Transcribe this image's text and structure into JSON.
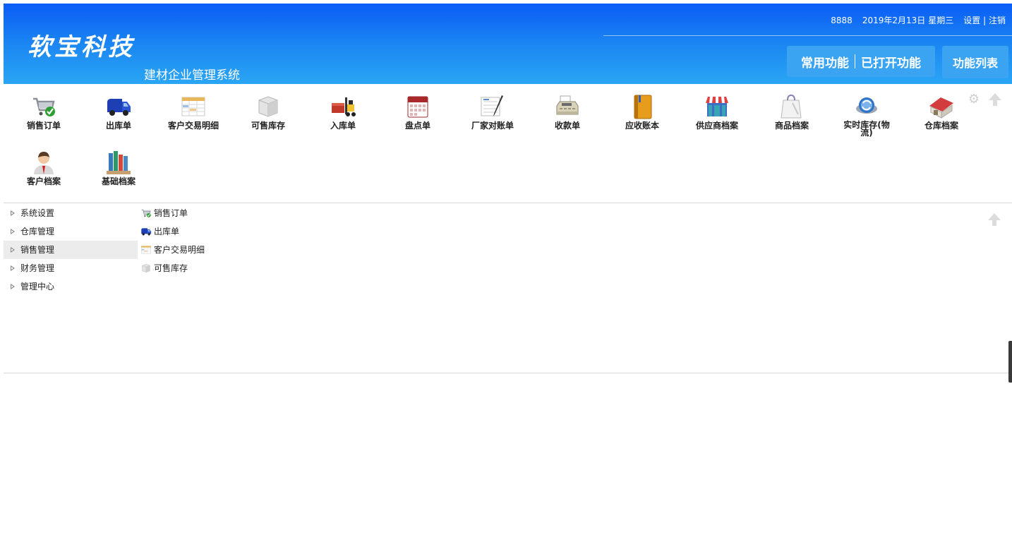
{
  "header": {
    "logo_text": "软宝科技",
    "subtitle": "建材企业管理系统",
    "user_id": "8888",
    "date": "2019年2月13日",
    "weekday": "星期三",
    "settings_label": "设置",
    "logout_label": "注销",
    "tab_common": "常用功能",
    "tab_opened": "已打开功能",
    "func_list_label": "功能列表",
    "colors": {
      "header_top": "#0a5cf6",
      "header_bottom": "#2aa6f5",
      "tab_bg": "#3aa4f3"
    }
  },
  "quick_functions": [
    {
      "label": "销售订单",
      "icon": "shopping-cart-icon"
    },
    {
      "label": "出库单",
      "icon": "truck-icon"
    },
    {
      "label": "客户交易明细",
      "icon": "spreadsheet-icon"
    },
    {
      "label": "可售库存",
      "icon": "boxes-icon"
    },
    {
      "label": "入库单",
      "icon": "forklift-icon"
    },
    {
      "label": "盘点单",
      "icon": "calendar-icon"
    },
    {
      "label": "厂家对账单",
      "icon": "ledger-pen-icon"
    },
    {
      "label": "收款单",
      "icon": "cash-register-icon"
    },
    {
      "label": "应收账本",
      "icon": "account-book-icon"
    },
    {
      "label": "供应商档案",
      "icon": "storefront-icon"
    },
    {
      "label": "商品档案",
      "icon": "shopping-bag-icon"
    },
    {
      "label": "实时库存(物流)",
      "icon": "refresh-globe-icon"
    },
    {
      "label": "仓库档案",
      "icon": "warehouse-icon"
    },
    {
      "label": "客户档案",
      "icon": "customer-person-icon"
    },
    {
      "label": "基础档案",
      "icon": "binders-icon"
    }
  ],
  "tree": [
    {
      "label": "系统设置",
      "selected": false
    },
    {
      "label": "仓库管理",
      "selected": false
    },
    {
      "label": "销售管理",
      "selected": true
    },
    {
      "label": "财务管理",
      "selected": false
    },
    {
      "label": "管理中心",
      "selected": false
    }
  ],
  "sub_items": [
    {
      "label": "销售订单",
      "icon": "shopping-cart-icon"
    },
    {
      "label": "出库单",
      "icon": "truck-icon"
    },
    {
      "label": "客户交易明细",
      "icon": "spreadsheet-icon"
    },
    {
      "label": "可售库存",
      "icon": "boxes-icon"
    }
  ]
}
